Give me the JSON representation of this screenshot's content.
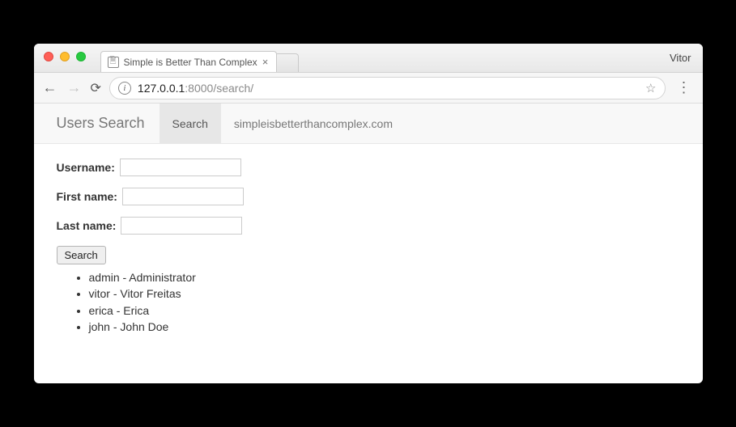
{
  "browser": {
    "profile_name": "Vitor",
    "tab_title": "Simple is Better Than Complex",
    "url_host": "127.0.0.1",
    "url_port_path": ":8000/search/"
  },
  "navbar": {
    "brand": "Users Search",
    "items": [
      {
        "label": "Search",
        "active": true
      },
      {
        "label": "simpleisbetterthancomplex.com",
        "active": false
      }
    ]
  },
  "form": {
    "username_label": "Username:",
    "firstname_label": "First name:",
    "lastname_label": "Last name:",
    "username_value": "",
    "firstname_value": "",
    "lastname_value": "",
    "submit_label": "Search"
  },
  "results": [
    "admin - Administrator",
    "vitor - Vitor Freitas",
    "erica - Erica",
    "john - John Doe"
  ]
}
